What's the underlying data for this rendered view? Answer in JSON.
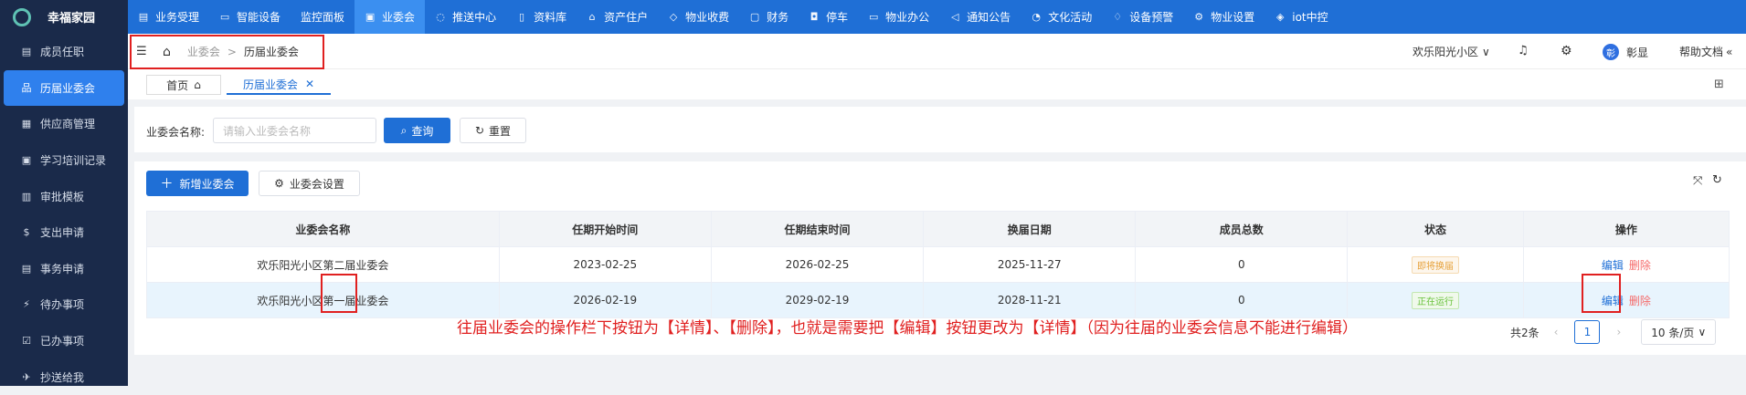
{
  "app": {
    "logo_text": "幸福家园"
  },
  "topnav": [
    {
      "icon": "app-grid-icon",
      "glyph": "▤",
      "label": "业务受理",
      "active": false
    },
    {
      "icon": "monitor-icon",
      "glyph": "▭",
      "label": "智能设备",
      "active": false
    },
    {
      "icon": "",
      "glyph": "",
      "label": "监控面板",
      "active": false
    },
    {
      "icon": "doc-icon",
      "glyph": "▣",
      "label": "业委会",
      "active": true
    },
    {
      "icon": "chat-icon",
      "glyph": "◌",
      "label": "推送中心",
      "active": false
    },
    {
      "icon": "file-icon",
      "glyph": "▯",
      "label": "资料库",
      "active": false
    },
    {
      "icon": "home-icon",
      "glyph": "⌂",
      "label": "资产住户",
      "active": false
    },
    {
      "icon": "shield-icon",
      "glyph": "◇",
      "label": "物业收费",
      "active": false
    },
    {
      "icon": "wallet-icon",
      "glyph": "▢",
      "label": "财务",
      "active": false
    },
    {
      "icon": "car-icon",
      "glyph": "◘",
      "label": "停车",
      "active": false
    },
    {
      "icon": "laptop-icon",
      "glyph": "▭",
      "label": "物业办公",
      "active": false
    },
    {
      "icon": "megaphone-icon",
      "glyph": "◁",
      "label": "通知公告",
      "active": false
    },
    {
      "icon": "flag-icon",
      "glyph": "◔",
      "label": "文化活动",
      "active": false
    },
    {
      "icon": "alarm-icon",
      "glyph": "♢",
      "label": "设备预警",
      "active": false
    },
    {
      "icon": "gear-icon",
      "glyph": "⚙",
      "label": "物业设置",
      "active": false
    },
    {
      "icon": "cube-icon",
      "glyph": "◈",
      "label": "iot中控",
      "active": false
    }
  ],
  "sidebar": [
    {
      "icon": "id-card-icon",
      "glyph": "▤",
      "label": "成员任职",
      "active": false
    },
    {
      "icon": "org-chart-icon",
      "glyph": "品",
      "label": "历届业委会",
      "active": true
    },
    {
      "icon": "supplier-icon",
      "glyph": "▦",
      "label": "供应商管理",
      "active": false
    },
    {
      "icon": "training-icon",
      "glyph": "▣",
      "label": "学习培训记录",
      "active": false
    },
    {
      "icon": "template-icon",
      "glyph": "▥",
      "label": "审批模板",
      "active": false
    },
    {
      "icon": "expense-icon",
      "glyph": "$",
      "label": "支出申请",
      "active": false
    },
    {
      "icon": "affair-icon",
      "glyph": "▤",
      "label": "事务申请",
      "active": false
    },
    {
      "icon": "todo-icon",
      "glyph": "⚡",
      "label": "待办事项",
      "active": false
    },
    {
      "icon": "done-icon",
      "glyph": "☑",
      "label": "已办事项",
      "active": false
    },
    {
      "icon": "cc-icon",
      "glyph": "✈",
      "label": "抄送给我",
      "active": false
    }
  ],
  "breadcrumb": {
    "parent": "业委会",
    "sep": ">",
    "current": "历届业委会"
  },
  "header_right": {
    "community": "欢乐阳光小区",
    "user_initial": "彰",
    "user_name": "彰显",
    "help": "帮助文档"
  },
  "tabs": [
    {
      "label": "首页"
    },
    {
      "label": "历届业委会"
    }
  ],
  "search": {
    "label": "业委会名称:",
    "placeholder": "请输入业委会名称",
    "query_button": "查询",
    "reset_button": "重置"
  },
  "toolbar": {
    "add_button": "新增业委会",
    "settings_button": "业委会设置"
  },
  "table": {
    "headers": [
      "业委会名称",
      "任期开始时间",
      "任期结束时间",
      "换届日期",
      "成员总数",
      "状态",
      "操作"
    ],
    "rows": [
      {
        "name": "欢乐阳光小区第二届业委会",
        "start": "2023-02-25",
        "end": "2026-02-25",
        "change": "2025-11-27",
        "members": "0",
        "status": "即将换届",
        "status_type": "warn",
        "edit": "编辑",
        "delete": "删除"
      },
      {
        "name": "欢乐阳光小区第一届业委会",
        "start": "2026-02-19",
        "end": "2029-02-19",
        "change": "2028-11-21",
        "members": "0",
        "status": "正在运行",
        "status_type": "ok",
        "edit": "编辑",
        "delete": "删除"
      }
    ]
  },
  "annotation": "往届业委会的操作栏下按钮为【详情】、【删除】，也就是需要把【编辑】按钮更改为【详情】（因为往届的业委会信息不能进行编辑）",
  "pagination": {
    "total": "共2条",
    "page": "1",
    "page_size": "10 条/页"
  },
  "colors": {
    "primary": "#1f6fd6",
    "sidebar_bg": "#1a2a4a",
    "annotation_red": "#e02020"
  }
}
